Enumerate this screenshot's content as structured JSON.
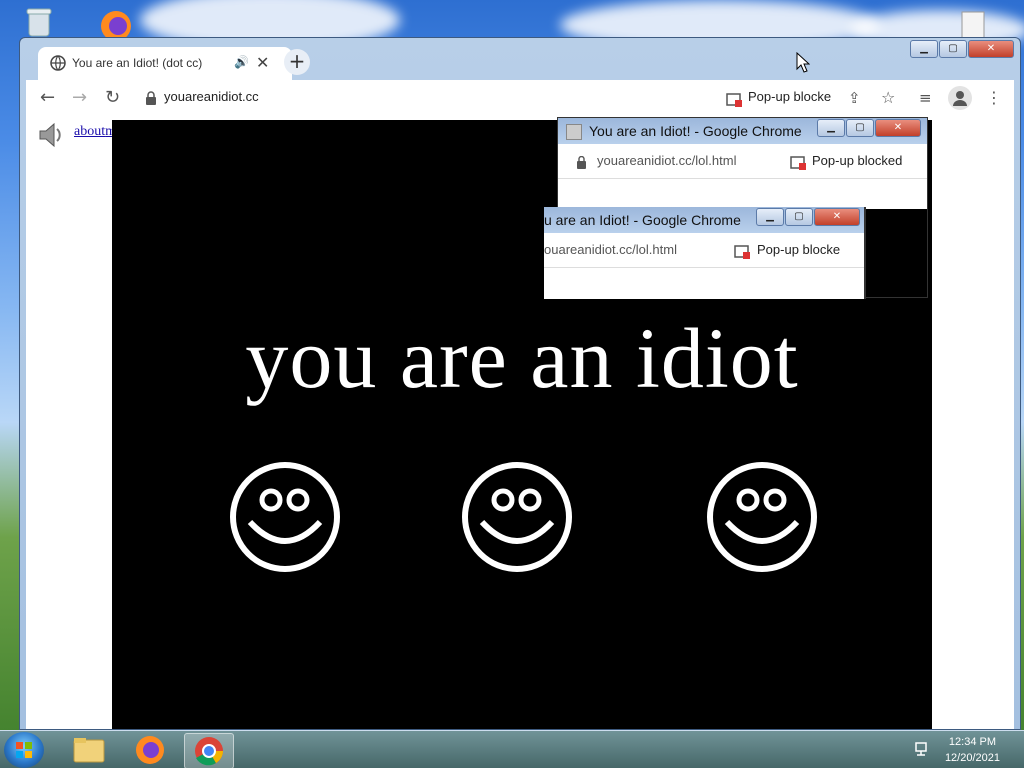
{
  "browser": {
    "tab_title": "You are an Idiot! (dot cc)",
    "url": "youareanidiot.cc",
    "popup_blocked": "Pop-up blocke"
  },
  "page": {
    "links": [
      "about",
      "mem"
    ],
    "headline": "you are an idiot",
    "smiley_count": 3
  },
  "popups": [
    {
      "title": "You are an Idiot! - Google Chrome",
      "url": "youareanidiot.cc/lol.html",
      "blocked": "Pop-up blocked"
    },
    {
      "title": "u are an Idiot! - Google Chrome",
      "url": "ouareanidiot.cc/lol.html",
      "blocked": "Pop-up blocke"
    }
  ],
  "taskbar": {
    "time": "12:34 PM",
    "date": "12/20/2021"
  },
  "colors": {
    "page_bg": "#000000",
    "text": "#ffffff",
    "link": "#1a0dab"
  }
}
